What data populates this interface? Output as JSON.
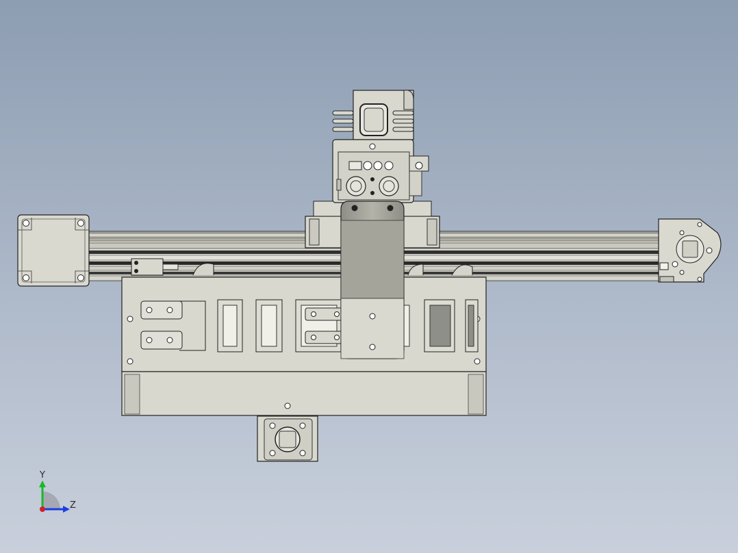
{
  "view": {
    "background_top": "#8d9db2",
    "background_bottom": "#c9d0dc",
    "part_fill": "#d6d6cc",
    "part_shade": "#a9a99f",
    "edge_color": "#222222"
  },
  "triad": {
    "y_label": "Y",
    "z_label": "Z",
    "y_color": "#18b82a",
    "z_color": "#1a3fe0",
    "x_color": "#d0202a"
  },
  "model": {
    "components": [
      "stepper-motor",
      "linear-rail",
      "end-idler",
      "carriage",
      "hotend-fan-shroud",
      "cable-chain",
      "chain-mount-plate",
      "profile-end-cap"
    ]
  }
}
